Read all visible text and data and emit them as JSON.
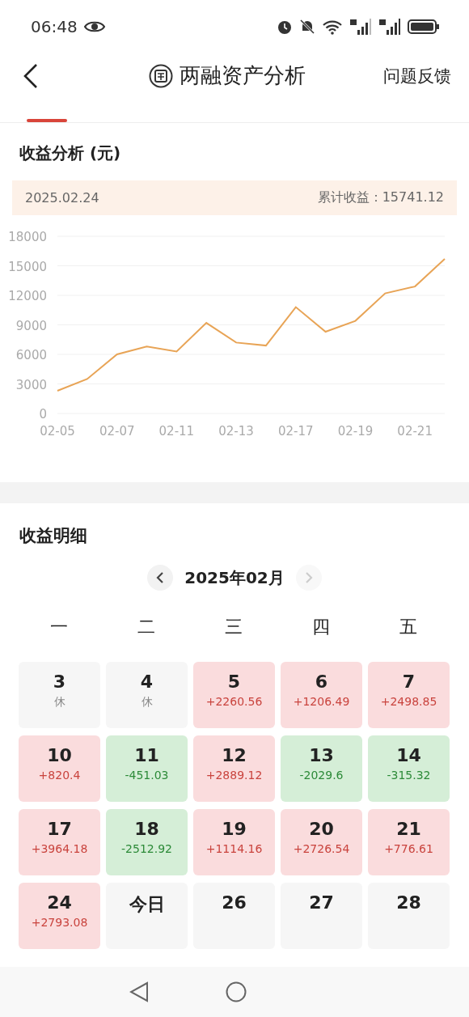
{
  "status_bar": {
    "time": "06:48"
  },
  "header": {
    "title": "两融资产分析",
    "action": "问题反馈"
  },
  "analysis": {
    "title": "收益分析 (元)",
    "date": "2025.02.24",
    "total_label": "累计收益：15741.12",
    "chart_data": {
      "type": "line",
      "categories": [
        "02-05",
        null,
        "02-07",
        null,
        "02-11",
        null,
        "02-13",
        null,
        "02-17",
        null,
        "02-19",
        null,
        "02-21",
        null
      ],
      "series": [
        {
          "color": "#e8a456",
          "values": [
            2300,
            3500,
            6000,
            6800,
            6300,
            9200,
            7200,
            6900,
            10800,
            8300,
            9400,
            12200,
            12900,
            15700
          ]
        }
      ],
      "grid": true,
      "ylim": [
        0,
        18000
      ],
      "yticks": [
        0,
        3000,
        6000,
        9000,
        12000,
        15000,
        18000
      ]
    }
  },
  "detail": {
    "title": "收益明细",
    "month": "2025年02月",
    "weekdays": [
      "一",
      "二",
      "三",
      "四",
      "五"
    ],
    "days": [
      {
        "day": "3",
        "note": "休",
        "kind": "holiday"
      },
      {
        "day": "4",
        "note": "休",
        "kind": "holiday"
      },
      {
        "day": "5",
        "note": "+2260.56",
        "kind": "gain"
      },
      {
        "day": "6",
        "note": "+1206.49",
        "kind": "gain"
      },
      {
        "day": "7",
        "note": "+2498.85",
        "kind": "gain"
      },
      {
        "day": "10",
        "note": "+820.4",
        "kind": "gain"
      },
      {
        "day": "11",
        "note": "-451.03",
        "kind": "loss"
      },
      {
        "day": "12",
        "note": "+2889.12",
        "kind": "gain"
      },
      {
        "day": "13",
        "note": "-2029.6",
        "kind": "loss"
      },
      {
        "day": "14",
        "note": "-315.32",
        "kind": "loss"
      },
      {
        "day": "17",
        "note": "+3964.18",
        "kind": "gain"
      },
      {
        "day": "18",
        "note": "-2512.92",
        "kind": "loss"
      },
      {
        "day": "19",
        "note": "+1114.16",
        "kind": "gain"
      },
      {
        "day": "20",
        "note": "+2726.54",
        "kind": "gain"
      },
      {
        "day": "21",
        "note": "+776.61",
        "kind": "gain"
      },
      {
        "day": "24",
        "note": "+2793.08",
        "kind": "gain"
      },
      {
        "day": "今日",
        "kind": "future"
      },
      {
        "day": "26",
        "kind": "future"
      },
      {
        "day": "27",
        "kind": "future"
      },
      {
        "day": "28",
        "kind": "future"
      }
    ]
  }
}
